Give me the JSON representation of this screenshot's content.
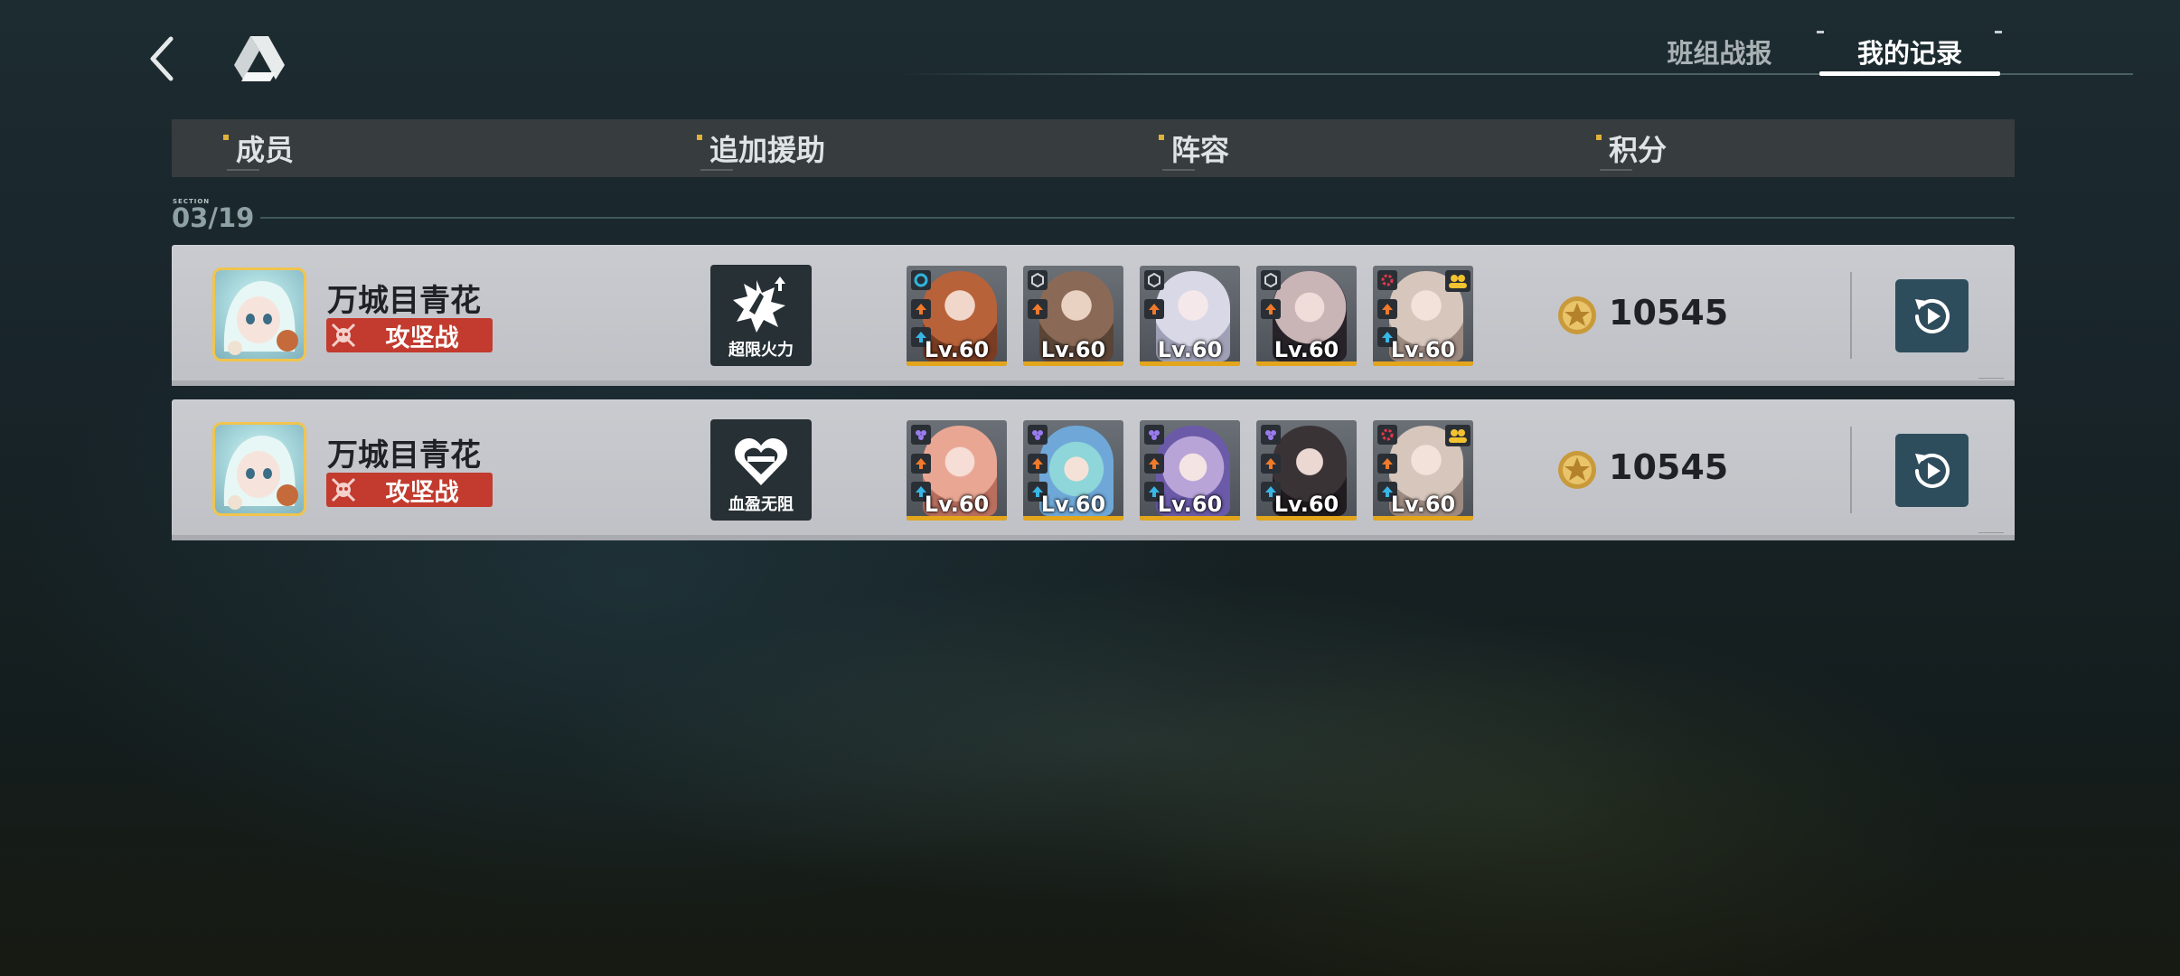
{
  "header": {
    "tabs": [
      {
        "label": "班组战报",
        "active": false
      },
      {
        "label": "我的记录",
        "active": true
      }
    ]
  },
  "columns": [
    "成员",
    "追加援助",
    "阵容",
    "积分"
  ],
  "section": {
    "tag": "SECTION",
    "date": "03/19"
  },
  "records": [
    {
      "member_name": "万城目青花",
      "mode": "攻坚战",
      "support": {
        "label": "超限火力",
        "icon": "overdrive-fire-icon"
      },
      "lineup": [
        {
          "level": "Lv.60",
          "icons": [
            "cyan-swirl-icon",
            "orange-up-icon",
            "blue-up-icon"
          ],
          "team_icon": false
        },
        {
          "level": "Lv.60",
          "icons": [
            "grey-hex-icon",
            "orange-up-icon"
          ],
          "team_icon": false
        },
        {
          "level": "Lv.60",
          "icons": [
            "grey-hex-icon",
            "orange-up-icon"
          ],
          "team_icon": false
        },
        {
          "level": "Lv.60",
          "icons": [
            "grey-hex-icon",
            "orange-up-icon"
          ],
          "team_icon": false
        },
        {
          "level": "Lv.60",
          "icons": [
            "red-gear-icon",
            "orange-up-icon",
            "blue-up-icon"
          ],
          "team_icon": true
        }
      ],
      "score": "10545"
    },
    {
      "member_name": "万城目青花",
      "mode": "攻坚战",
      "support": {
        "label": "血盈无阻",
        "icon": "heart-shield-icon"
      },
      "lineup": [
        {
          "level": "Lv.60",
          "icons": [
            "purple-dots-icon",
            "orange-up-icon",
            "blue-up-icon"
          ],
          "team_icon": false
        },
        {
          "level": "Lv.60",
          "icons": [
            "purple-dots-icon",
            "orange-up-icon",
            "blue-up-icon"
          ],
          "team_icon": false
        },
        {
          "level": "Lv.60",
          "icons": [
            "purple-dots-icon",
            "orange-up-icon",
            "blue-up-icon"
          ],
          "team_icon": false
        },
        {
          "level": "Lv.60",
          "icons": [
            "purple-dots-icon",
            "orange-up-icon",
            "blue-up-icon"
          ],
          "team_icon": false
        },
        {
          "level": "Lv.60",
          "icons": [
            "red-gear-icon",
            "orange-up-icon",
            "blue-up-icon"
          ],
          "team_icon": true
        }
      ],
      "score": "10545"
    }
  ],
  "colors": {
    "accent_gold": "#e3a51b",
    "mode_red": "#c23b2e",
    "replay_teal": "#2e4d5c",
    "row_bg": "#c6c8cd"
  }
}
